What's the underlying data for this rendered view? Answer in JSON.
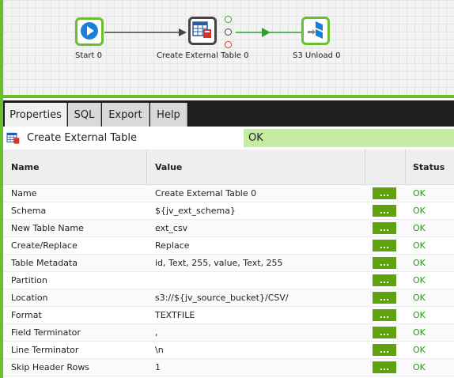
{
  "canvas": {
    "nodes": [
      {
        "label": "Start 0",
        "icon": "play-icon"
      },
      {
        "label": "Create External Table 0",
        "icon": "table-icon"
      },
      {
        "label": "S3 Unload 0",
        "icon": "s3-unload-icon"
      }
    ]
  },
  "tabs": [
    "Properties",
    "SQL",
    "Export",
    "Help"
  ],
  "component": {
    "name": "Create External Table",
    "status": "OK"
  },
  "table": {
    "headers": {
      "name": "Name",
      "value": "Value",
      "status": "Status"
    },
    "rows": [
      {
        "name": "Name",
        "value": "Create External Table 0",
        "button": "...",
        "status": "OK"
      },
      {
        "name": "Schema",
        "value": "${jv_ext_schema}",
        "button": "...",
        "status": "OK"
      },
      {
        "name": "New Table Name",
        "value": "ext_csv",
        "button": "...",
        "status": "OK"
      },
      {
        "name": "Create/Replace",
        "value": "Replace",
        "button": "...",
        "status": "OK"
      },
      {
        "name": "Table Metadata",
        "value": "id, Text, 255, value, Text, 255",
        "button": "...",
        "status": "OK"
      },
      {
        "name": "Partition",
        "value": "",
        "button": "...",
        "status": "OK"
      },
      {
        "name": "Location",
        "value": "s3://${jv_source_bucket}/CSV/",
        "button": "...",
        "status": "OK"
      },
      {
        "name": "Format",
        "value": "TEXTFILE",
        "button": "...",
        "status": "OK"
      },
      {
        "name": "Field Terminator",
        "value": ",",
        "button": "...",
        "status": "OK"
      },
      {
        "name": "Line Terminator",
        "value": "\\n",
        "button": "...",
        "status": "OK"
      },
      {
        "name": "Skip Header Rows",
        "value": "1",
        "button": "...",
        "status": "OK"
      }
    ]
  },
  "colors": {
    "accent": "#6abf2e",
    "ok": "#2a9a1a",
    "status_bg": "#c6eca4",
    "button": "#5fa10e"
  }
}
